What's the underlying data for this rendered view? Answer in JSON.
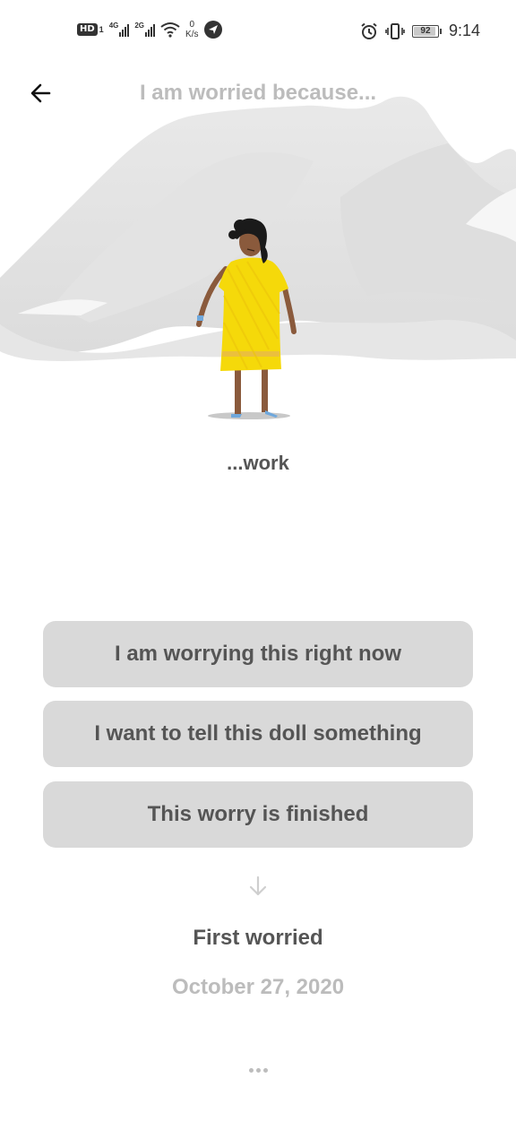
{
  "status_bar": {
    "hd_label": "HD",
    "hd_sub": "1",
    "net1_label": "4G",
    "net2_label": "2G",
    "speed_value": "0",
    "speed_unit": "K/s",
    "battery_level": "92",
    "battery_fraction": 0.92,
    "time": "9:14",
    "icons": [
      "signal-icon",
      "wifi-icon",
      "location-icon",
      "alarm-icon",
      "vibrate-icon",
      "battery-icon"
    ]
  },
  "header": {
    "title": "I am worried because...",
    "back_icon": "arrow-left-icon"
  },
  "illustration": {
    "description_icon": "doll-illustration",
    "dress_color": "#f5d90a",
    "skin_color": "#8a5a3c"
  },
  "worry": {
    "topic": "...work"
  },
  "actions": {
    "worrying_now": "I am worrying this right now",
    "tell_doll": "I want to tell this doll something",
    "finished": "This worry is finished"
  },
  "history": {
    "label": "First worried",
    "date": "October 27, 2020"
  },
  "colors": {
    "button_bg": "#d9d9d9",
    "muted_text": "#bcbcbc",
    "primary_text": "#555555"
  }
}
